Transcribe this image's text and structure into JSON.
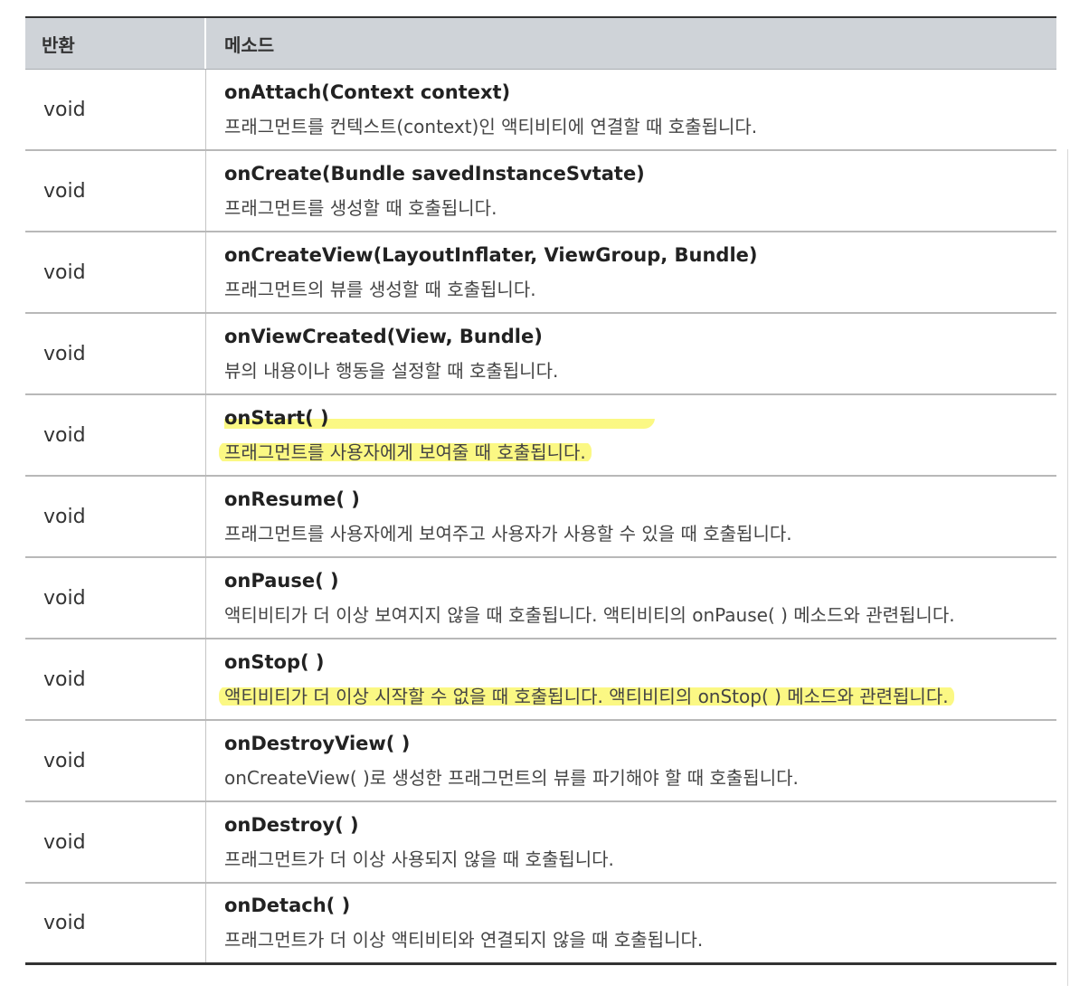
{
  "header": {
    "return_label": "반환",
    "method_label": "메소드"
  },
  "rows": [
    {
      "ret": "void",
      "sig": "onAttach(Context context)",
      "desc": "프래그먼트를 컨텍스트(context)인 액티비티에 연결할 때 호출됩니다."
    },
    {
      "ret": "void",
      "sig": "onCreate(Bundle savedInstanceSvtate)",
      "desc": "프래그먼트를 생성할 때 호출됩니다."
    },
    {
      "ret": "void",
      "sig": "onCreateView(LayoutInflater, ViewGroup, Bundle)",
      "desc": "프래그먼트의 뷰를 생성할 때 호출됩니다."
    },
    {
      "ret": "void",
      "sig": "onViewCreated(View, Bundle)",
      "desc": "뷰의 내용이나 행동을 설정할 때 호출됩니다."
    },
    {
      "ret": "void",
      "sig": "onStart( )",
      "desc": "프래그먼트를 사용자에게 보여줄 때 호출됩니다.",
      "highlighted": true
    },
    {
      "ret": "void",
      "sig": "onResume( )",
      "desc": "프래그먼트를 사용자에게 보여주고 사용자가 사용할 수 있을 때 호출됩니다."
    },
    {
      "ret": "void",
      "sig": "onPause( )",
      "desc": "액티비티가 더 이상 보여지지 않을 때 호출됩니다. 액티비티의 onPause( ) 메소드와 관련됩니다."
    },
    {
      "ret": "void",
      "sig": "onStop( )",
      "desc": "액티비티가 더 이상 시작할 수 없을 때 호출됩니다. 액티비티의 onStop( ) 메소드와 관련됩니다.",
      "highlighted": true
    },
    {
      "ret": "void",
      "sig": "onDestroyView( )",
      "desc": "onCreateView( )로 생성한 프래그먼트의 뷰를 파기해야 할 때 호출됩니다."
    },
    {
      "ret": "void",
      "sig": "onDestroy( )",
      "desc": "프래그먼트가 더 이상 사용되지 않을 때 호출됩니다."
    },
    {
      "ret": "void",
      "sig": "onDetach( )",
      "desc": "프래그먼트가 더 이상 액티비티와 연결되지 않을 때 호출됩니다."
    }
  ],
  "colors": {
    "header_bg": "#cfd3d8",
    "highlight": "#faf55a",
    "rule": "#333333"
  }
}
